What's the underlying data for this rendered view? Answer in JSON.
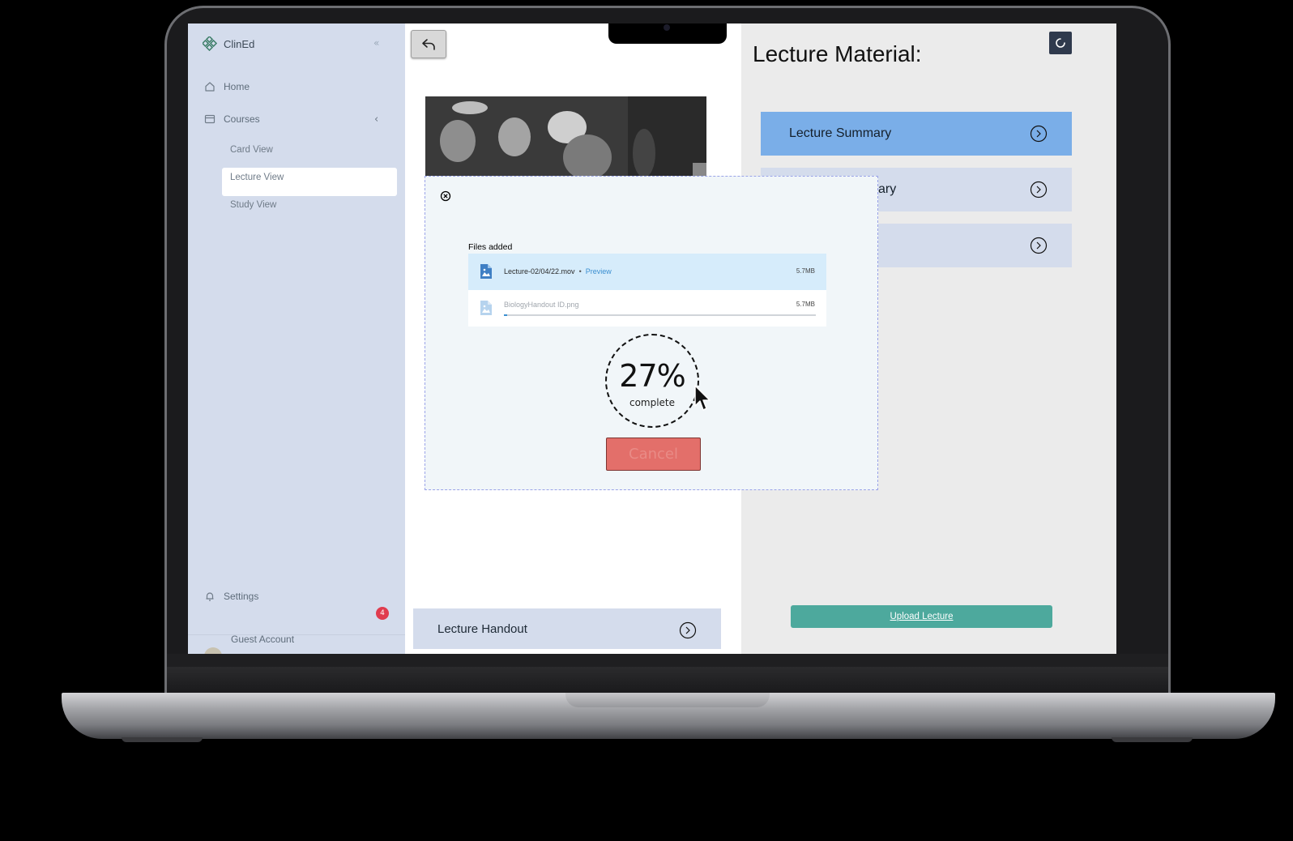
{
  "sidebar": {
    "brand": "ClinEd",
    "collapse_icon": "«",
    "home": "Home",
    "courses": "Courses",
    "courses_chevron": "‹",
    "sub_items": [
      "Card View",
      "Lecture View",
      "Study View"
    ],
    "settings": "Settings",
    "settings_badge": "4",
    "account": "Guest Account"
  },
  "main": {
    "handout_label": "Lecture Handout"
  },
  "right_panel": {
    "title": "Lecture Material:",
    "accordion": [
      {
        "label": "Lecture Summary"
      },
      {
        "label": "ary"
      },
      {
        "label": ""
      }
    ],
    "upload_label": "Upload Lecture"
  },
  "modal": {
    "files_title": "Files added",
    "files": [
      {
        "name": "Lecture-02/04/22.mov",
        "action": "Preview",
        "size": "5.7MB"
      },
      {
        "name": "BiologyHandout ID.png",
        "size": "5.7MB",
        "progress": 0.01
      }
    ],
    "percent": "27%",
    "percent_label": "complete",
    "cancel_label": "Cancel"
  },
  "colors": {
    "sidebar_bg": "#d4dcec",
    "accordion_active": "#7aaee8",
    "upload_button": "#4da99d",
    "cancel_button": "#e36f6a",
    "modal_border": "#9aa3e8"
  }
}
